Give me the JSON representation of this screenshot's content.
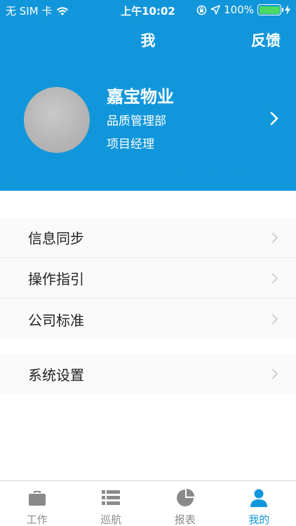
{
  "status_bar": {
    "carrier": "无 SIM 卡",
    "time": "上午10:02",
    "battery": "100%"
  },
  "nav": {
    "title": "我",
    "feedback_label": "反馈"
  },
  "profile": {
    "name": "嘉宝物业",
    "department": "品质管理部",
    "role": "项目经理"
  },
  "menu_group_1": [
    {
      "label": "信息同步"
    },
    {
      "label": "操作指引"
    },
    {
      "label": "公司标准"
    }
  ],
  "menu_group_2": [
    {
      "label": "系统设置"
    }
  ],
  "tabs": [
    {
      "label": "工作",
      "icon": "briefcase-icon"
    },
    {
      "label": "巡航",
      "icon": "list-icon"
    },
    {
      "label": "报表",
      "icon": "pie-chart-icon"
    },
    {
      "label": "我的",
      "icon": "person-icon",
      "active": true
    }
  ],
  "colors": {
    "primary": "#1296db",
    "tab_inactive": "#8a8a8a",
    "battery": "#4cd964"
  }
}
